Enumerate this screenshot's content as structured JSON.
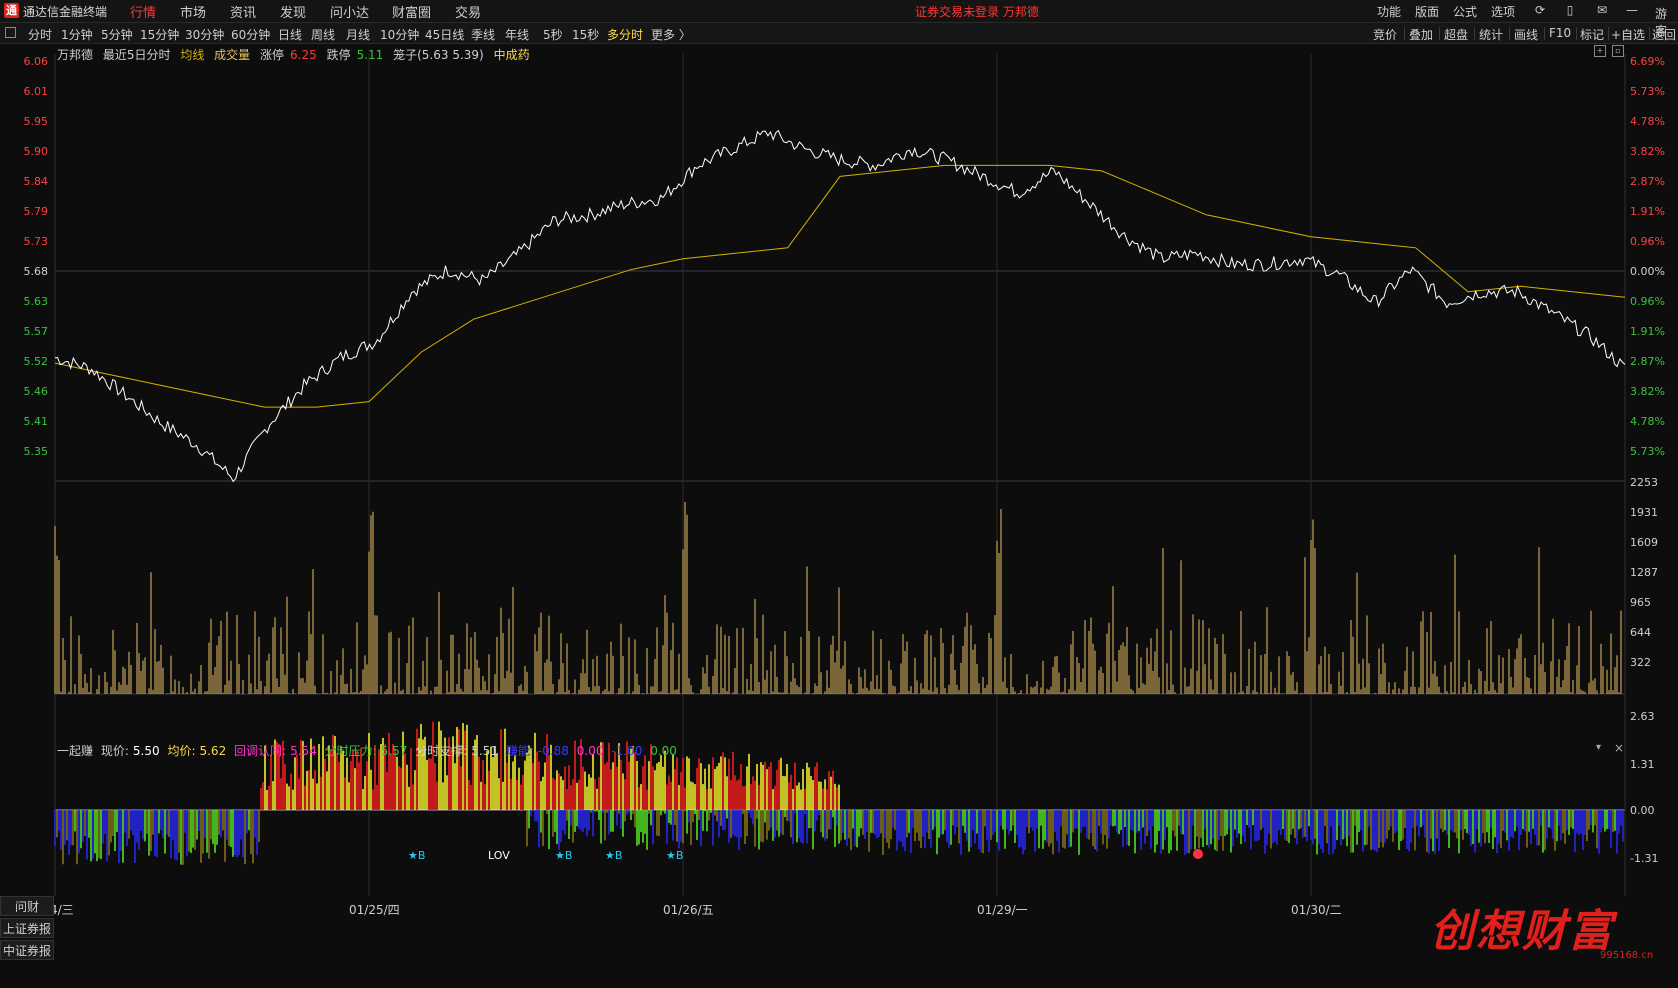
{
  "app": {
    "title": "通达信金融终端",
    "logo": "通"
  },
  "menu": [
    "行情",
    "市场",
    "资讯",
    "发现",
    "问小达",
    "财富圈",
    "交易"
  ],
  "notice": "证券交易未登录  万邦德",
  "top_right": [
    "功能",
    "版面",
    "公式",
    "选项"
  ],
  "top_right_icons": [
    "refresh-icon",
    "phone-icon",
    "mail-icon"
  ],
  "corner_text": "游客",
  "tabs": [
    "分时",
    "1分钟",
    "5分钟",
    "15分钟",
    "30分钟",
    "60分钟",
    "日线",
    "周线",
    "月线",
    "10分钟",
    "45日线",
    "季线",
    "年线",
    "5秒",
    "15秒",
    "多分时",
    "更多 〉"
  ],
  "active_tab": "多分时",
  "right_tools": [
    "竞价",
    "叠加",
    "超盘",
    "统计",
    "画线",
    "F10",
    "标记",
    "+自选",
    "返回"
  ],
  "info": {
    "stock": "万邦德",
    "period": "最近5日分时",
    "avg_line": "均线",
    "volume": "成交量",
    "limit_up_label": "涨停",
    "limit_up": "6.25",
    "limit_down_label": "跌停",
    "limit_down": "5.11",
    "cage": "笼子(5.63 5.39)",
    "sector": "中成药"
  },
  "indicator": {
    "name": "一起赚",
    "price_label": "现价:",
    "price": "5.50",
    "avg_label": "均价:",
    "avg": "5.62",
    "retest_label": "回调认同:",
    "retest": "5.54",
    "pressure_label": "分时压力:",
    "pressure": "5.57",
    "support_label": "分时支撑:",
    "support": "5.51",
    "extra_label": "赚能:",
    "extra1": "-0.88",
    "extra2": "0.00",
    "extra3": "-1.00",
    "extra4": "0.00"
  },
  "left_buttons": [
    "问财",
    "上证券报",
    "中证券报"
  ],
  "price_axis_left": [
    "6.06",
    "6.01",
    "5.95",
    "5.90",
    "5.84",
    "5.79",
    "5.73",
    "5.68",
    "5.63",
    "5.57",
    "5.52",
    "5.46",
    "5.41",
    "5.35"
  ],
  "price_axis_right": [
    "6.69%",
    "5.73%",
    "4.78%",
    "3.82%",
    "2.87%",
    "1.91%",
    "0.96%",
    "0.00%",
    "0.96%",
    "1.91%",
    "2.87%",
    "3.82%",
    "4.78%",
    "5.73%"
  ],
  "volume_axis": [
    "2253",
    "1931",
    "1609",
    "1287",
    "965",
    "644",
    "322"
  ],
  "indicator_axis": [
    "2.63",
    "1.31",
    "0.00",
    "-1.31"
  ],
  "date_axis": [
    "01/24/三",
    "01/25/四",
    "01/26/五",
    "01/29/一",
    "01/30/二"
  ],
  "signals": [
    "★B",
    "LOV",
    "★B",
    "★B",
    "★B"
  ],
  "watermark": {
    "text": "创想财富",
    "site": "995168.cn"
  },
  "colors": {
    "background": "#0d0d0d",
    "price_line": "#ffffff",
    "avg_line": "#d4b200",
    "volume": "#e8c062",
    "up": "#ff3a3a",
    "down": "#3ac43a",
    "accent": "#ffd94a"
  },
  "chart_data": {
    "type": "line",
    "title": "最近5日分时",
    "days": [
      "01/24/三",
      "01/25/四",
      "01/26/五",
      "01/29/一",
      "01/30/二"
    ],
    "prev_close": 5.68,
    "ylim": [
      5.3,
      6.08
    ],
    "series": [
      {
        "name": "价格",
        "values": [
          5.52,
          5.5,
          5.45,
          5.4,
          5.36,
          5.3,
          5.4,
          5.47,
          5.52,
          5.55,
          5.64,
          5.68,
          5.66,
          5.71,
          5.77,
          5.78,
          5.8,
          5.81,
          5.87,
          5.9,
          5.93,
          5.9,
          5.88,
          5.87,
          5.9,
          5.88,
          5.85,
          5.82,
          5.86,
          5.8,
          5.74,
          5.7,
          5.71,
          5.69,
          5.69,
          5.7,
          5.67,
          5.62,
          5.68,
          5.62,
          5.64,
          5.64,
          5.6,
          5.56,
          5.5
        ]
      },
      {
        "name": "均线",
        "values": [
          5.51,
          5.49,
          5.47,
          5.45,
          5.43,
          5.43,
          5.44,
          5.53,
          5.59,
          5.62,
          5.65,
          5.68,
          5.7,
          5.71,
          5.72,
          5.85,
          5.86,
          5.87,
          5.87,
          5.87,
          5.86,
          5.82,
          5.78,
          5.76,
          5.74,
          5.73,
          5.72,
          5.64,
          5.65,
          5.64,
          5.63
        ]
      }
    ],
    "volume_ylim": [
      0,
      2253
    ]
  }
}
